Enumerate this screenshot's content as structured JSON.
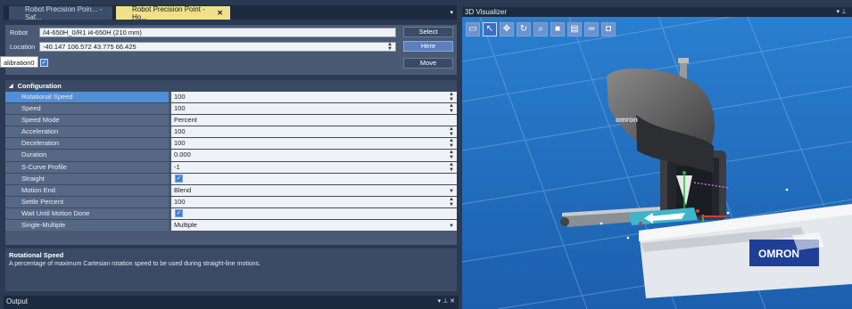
{
  "tabs": [
    {
      "label": "Robot Precision Poin... - Saf...",
      "active": false
    },
    {
      "label": "Robot Precision Point - Ho...",
      "active": true,
      "close": "✕"
    }
  ],
  "form": {
    "robot_label": "Robot",
    "robot_value": "/i4-650H_0/R1 i4-650H (210 mm)",
    "select_button": "Select",
    "location_label": "Location",
    "location_value": "-40.147 106.572 43.775 66.425",
    "here_button": "Here",
    "calibration_label": "alibration0",
    "move_button": "Move"
  },
  "configuration": {
    "header": "Configuration",
    "rows": [
      {
        "name": "Rotational Speed",
        "value": "100",
        "control": "spin",
        "selected": true
      },
      {
        "name": "Speed",
        "value": "100",
        "control": "spin"
      },
      {
        "name": "Speed Mode",
        "value": "Percent",
        "control": "none"
      },
      {
        "name": "Acceleration",
        "value": "100",
        "control": "spin"
      },
      {
        "name": "Deceleration",
        "value": "100",
        "control": "spin"
      },
      {
        "name": "Duration",
        "value": "0.000",
        "control": "spin"
      },
      {
        "name": "S-Curve Profile",
        "value": "-1",
        "control": "spin"
      },
      {
        "name": "Straight",
        "value": "",
        "control": "check"
      },
      {
        "name": "Motion End",
        "value": "Blend",
        "control": "dropdown"
      },
      {
        "name": "Settle Percent",
        "value": "100",
        "control": "spin"
      },
      {
        "name": "Wait Until Motion Done",
        "value": "",
        "control": "check"
      },
      {
        "name": "Single-Multiple",
        "value": "Multiple",
        "control": "dropdown"
      }
    ]
  },
  "description": {
    "title": "Rotational Speed",
    "text": "A percentage of maximum Cartesian rotation speed to be used during straight-line motions."
  },
  "output_panel": {
    "title": "Output",
    "controls": "▾ ⊥ ✕"
  },
  "visualizer": {
    "title": "3D Visualizer",
    "controls": "▾ ⊥",
    "robot_brand": "omron",
    "cabinet_brand": "OMRON",
    "toolbar": [
      "view-icon",
      "pointer-icon",
      "move-icon",
      "rotate-icon",
      "measure-icon",
      "cube-icon",
      "page-icon",
      "align-icon",
      "camera-icon"
    ]
  },
  "colors": {
    "accent": "#4f8fd8",
    "active_tab": "#f0e08a",
    "panel": "#4a5a74"
  }
}
